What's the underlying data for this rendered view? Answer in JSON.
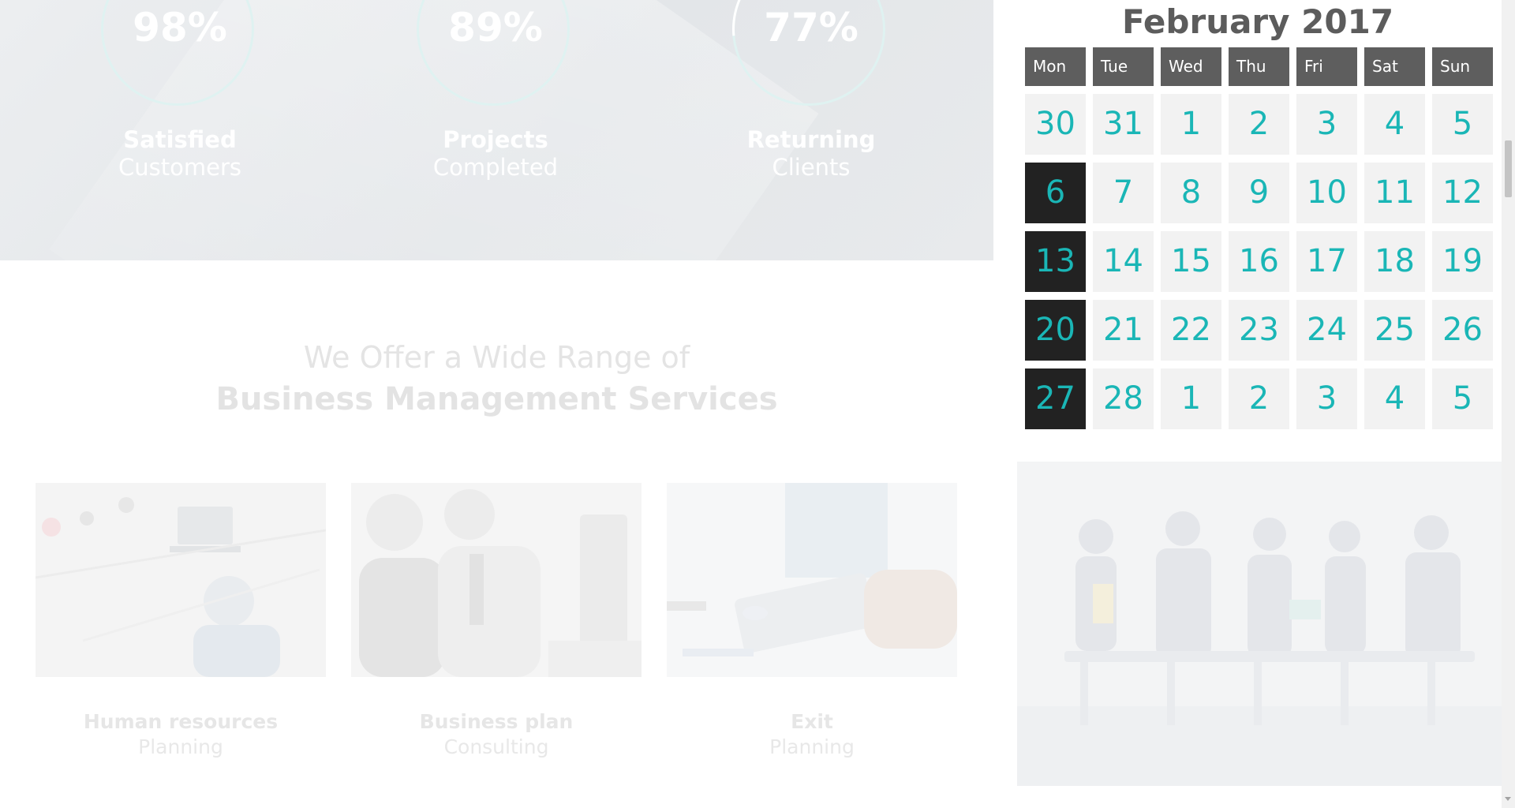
{
  "stats": [
    {
      "value": "98%",
      "line1": "Satisfied",
      "line2": "Customers"
    },
    {
      "value": "89%",
      "line1": "Projects",
      "line2": "Completed"
    },
    {
      "value": "77%",
      "line1": "Returning",
      "line2": "Clients"
    }
  ],
  "services": {
    "heading_light": "We Offer a Wide Range of",
    "heading_bold": "Business Management Services",
    "items": [
      {
        "title": "Human resources",
        "subtitle": "Planning",
        "icon": "office-desk-photo"
      },
      {
        "title": "Business plan",
        "subtitle": "Consulting",
        "icon": "call-center-photo"
      },
      {
        "title": "Exit",
        "subtitle": "Planning",
        "icon": "calculator-photo"
      }
    ]
  },
  "calendar": {
    "title": "February 2017",
    "weekdays": [
      "Mon",
      "Tue",
      "Wed",
      "Thu",
      "Fri",
      "Sat",
      "Sun"
    ],
    "weeks": [
      [
        "30",
        "31",
        "1",
        "2",
        "3",
        "4",
        "5"
      ],
      [
        "6",
        "7",
        "8",
        "9",
        "10",
        "11",
        "12"
      ],
      [
        "13",
        "14",
        "15",
        "16",
        "17",
        "18",
        "19"
      ],
      [
        "20",
        "21",
        "22",
        "23",
        "24",
        "25",
        "26"
      ],
      [
        "27",
        "28",
        "1",
        "2",
        "3",
        "4",
        "5"
      ]
    ]
  },
  "side_photo": {
    "icon": "job-applicants-photo"
  },
  "colors": {
    "accent": "#1ab6b6",
    "header": "#5e5e5e",
    "highlight": "#222222"
  }
}
